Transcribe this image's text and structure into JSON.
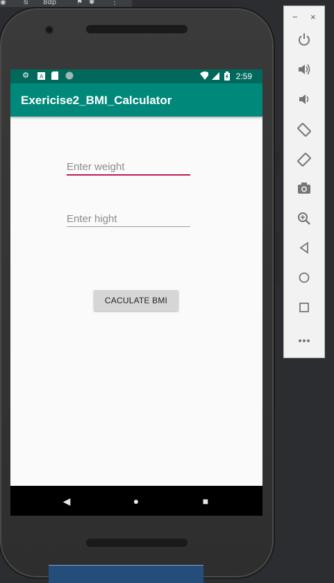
{
  "ide": {
    "toolbar_text": "8dp"
  },
  "status_bar": {
    "time": "2:59"
  },
  "app_bar": {
    "title": "Exericise2_BMI_Calculator"
  },
  "form": {
    "weight_placeholder": "Enter weight",
    "height_placeholder": "Enter hight",
    "button_label": "CACULATE BMI"
  },
  "colors": {
    "primary": "#00897b",
    "primary_dark": "#00695c",
    "accent": "#c2185b"
  },
  "emulator_panel": {
    "window_controls": {
      "minimize": "−",
      "close": "×"
    },
    "tools": [
      {
        "name": "power",
        "glyph": "⏻"
      },
      {
        "name": "volume-up",
        "glyph": "🔊"
      },
      {
        "name": "volume-down",
        "glyph": "🔉"
      },
      {
        "name": "rotate-left",
        "glyph": "⟲"
      },
      {
        "name": "rotate-right",
        "glyph": "⟳"
      },
      {
        "name": "screenshot",
        "glyph": "📷"
      },
      {
        "name": "zoom",
        "glyph": "🔍"
      },
      {
        "name": "back",
        "glyph": "◁"
      },
      {
        "name": "home",
        "glyph": "○"
      },
      {
        "name": "overview",
        "glyph": "□"
      },
      {
        "name": "more",
        "glyph": "•••"
      }
    ]
  },
  "navigation": {
    "back": "◀",
    "home": "●",
    "recents": "■"
  }
}
